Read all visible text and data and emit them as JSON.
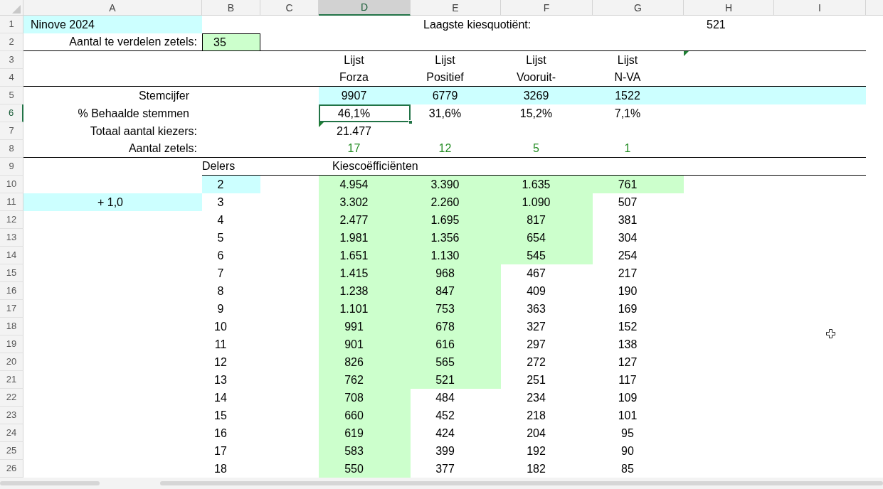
{
  "column_headers": [
    {
      "label": "A",
      "selected": false
    },
    {
      "label": "B",
      "selected": false
    },
    {
      "label": "C",
      "selected": false
    },
    {
      "label": "D",
      "selected": true
    },
    {
      "label": "E",
      "selected": false
    },
    {
      "label": "F",
      "selected": false
    },
    {
      "label": "G",
      "selected": false
    },
    {
      "label": "H",
      "selected": false
    },
    {
      "label": "I",
      "selected": false
    }
  ],
  "row_headers": [
    {
      "label": "1",
      "selected": false
    },
    {
      "label": "2",
      "selected": false
    },
    {
      "label": "3",
      "selected": false
    },
    {
      "label": "4",
      "selected": false
    },
    {
      "label": "5",
      "selected": false
    },
    {
      "label": "6",
      "selected": true
    },
    {
      "label": "7",
      "selected": false
    },
    {
      "label": "8",
      "selected": false
    },
    {
      "label": "9",
      "selected": false
    },
    {
      "label": "10",
      "selected": false
    },
    {
      "label": "11",
      "selected": false
    },
    {
      "label": "12",
      "selected": false
    },
    {
      "label": "13",
      "selected": false
    },
    {
      "label": "14",
      "selected": false
    },
    {
      "label": "15",
      "selected": false
    },
    {
      "label": "16",
      "selected": false
    },
    {
      "label": "17",
      "selected": false
    },
    {
      "label": "18",
      "selected": false
    },
    {
      "label": "19",
      "selected": false
    },
    {
      "label": "20",
      "selected": false
    },
    {
      "label": "21",
      "selected": false
    },
    {
      "label": "22",
      "selected": false
    },
    {
      "label": "23",
      "selected": false
    },
    {
      "label": "24",
      "selected": false
    },
    {
      "label": "25",
      "selected": false
    },
    {
      "label": "26",
      "selected": false
    }
  ],
  "title": "Ninove 2024",
  "lowest_quotient": {
    "label": "Laagste kiesquotiënt:",
    "value": "521"
  },
  "seats_to_distribute": {
    "label": "Aantal te verdelen zetels:",
    "value": "35"
  },
  "row_labels": {
    "votes": "Stemcijfer",
    "percent": "% Behaalde stemmen",
    "total_voters": "Totaal aantal kiezers:",
    "seats": "Aantal zetels:"
  },
  "total_voters": "21.477",
  "divisors_header": "Delers",
  "quotients_header": "Kiescoëfficiënten",
  "increment": "+ 1,0",
  "divisors": [
    "2",
    "3",
    "4",
    "5",
    "6",
    "7",
    "8",
    "9",
    "10",
    "11",
    "12",
    "13",
    "14",
    "15",
    "16",
    "17",
    "18"
  ],
  "parties": [
    {
      "line1": "Lijst",
      "line2": "Forza",
      "votes": "9907",
      "percent": "46,1%",
      "seats": "17",
      "quotients": [
        {
          "value": "4.954",
          "highlighted": true
        },
        {
          "value": "3.302",
          "highlighted": true
        },
        {
          "value": "2.477",
          "highlighted": true
        },
        {
          "value": "1.981",
          "highlighted": true
        },
        {
          "value": "1.651",
          "highlighted": true
        },
        {
          "value": "1.415",
          "highlighted": true
        },
        {
          "value": "1.238",
          "highlighted": true
        },
        {
          "value": "1.101",
          "highlighted": true
        },
        {
          "value": "991",
          "highlighted": true
        },
        {
          "value": "901",
          "highlighted": true
        },
        {
          "value": "826",
          "highlighted": true
        },
        {
          "value": "762",
          "highlighted": true
        },
        {
          "value": "708",
          "highlighted": true
        },
        {
          "value": "660",
          "highlighted": true
        },
        {
          "value": "619",
          "highlighted": true
        },
        {
          "value": "583",
          "highlighted": true
        },
        {
          "value": "550",
          "highlighted": true
        }
      ]
    },
    {
      "line1": "Lijst",
      "line2": "Positief",
      "votes": "6779",
      "percent": "31,6%",
      "seats": "12",
      "quotients": [
        {
          "value": "3.390",
          "highlighted": true
        },
        {
          "value": "2.260",
          "highlighted": true
        },
        {
          "value": "1.695",
          "highlighted": true
        },
        {
          "value": "1.356",
          "highlighted": true
        },
        {
          "value": "1.130",
          "highlighted": true
        },
        {
          "value": "968",
          "highlighted": true
        },
        {
          "value": "847",
          "highlighted": true
        },
        {
          "value": "753",
          "highlighted": true
        },
        {
          "value": "678",
          "highlighted": true
        },
        {
          "value": "616",
          "highlighted": true
        },
        {
          "value": "565",
          "highlighted": true
        },
        {
          "value": "521",
          "highlighted": true
        },
        {
          "value": "484",
          "highlighted": false
        },
        {
          "value": "452",
          "highlighted": false
        },
        {
          "value": "424",
          "highlighted": false
        },
        {
          "value": "399",
          "highlighted": false
        },
        {
          "value": "377",
          "highlighted": false
        }
      ]
    },
    {
      "line1": "Lijst",
      "line2": "Vooruit-",
      "votes": "3269",
      "percent": "15,2%",
      "seats": "5",
      "quotients": [
        {
          "value": "1.635",
          "highlighted": true
        },
        {
          "value": "1.090",
          "highlighted": true
        },
        {
          "value": "817",
          "highlighted": true
        },
        {
          "value": "654",
          "highlighted": true
        },
        {
          "value": "545",
          "highlighted": true
        },
        {
          "value": "467",
          "highlighted": false
        },
        {
          "value": "409",
          "highlighted": false
        },
        {
          "value": "363",
          "highlighted": false
        },
        {
          "value": "327",
          "highlighted": false
        },
        {
          "value": "297",
          "highlighted": false
        },
        {
          "value": "272",
          "highlighted": false
        },
        {
          "value": "251",
          "highlighted": false
        },
        {
          "value": "234",
          "highlighted": false
        },
        {
          "value": "218",
          "highlighted": false
        },
        {
          "value": "204",
          "highlighted": false
        },
        {
          "value": "192",
          "highlighted": false
        },
        {
          "value": "182",
          "highlighted": false
        }
      ]
    },
    {
      "line1": "Lijst",
      "line2": "N-VA",
      "votes": "1522",
      "percent": "7,1%",
      "seats": "1",
      "quotients": [
        {
          "value": "761",
          "highlighted": true
        },
        {
          "value": "507",
          "highlighted": false
        },
        {
          "value": "381",
          "highlighted": false
        },
        {
          "value": "304",
          "highlighted": false
        },
        {
          "value": "254",
          "highlighted": false
        },
        {
          "value": "217",
          "highlighted": false
        },
        {
          "value": "190",
          "highlighted": false
        },
        {
          "value": "169",
          "highlighted": false
        },
        {
          "value": "152",
          "highlighted": false
        },
        {
          "value": "138",
          "highlighted": false
        },
        {
          "value": "127",
          "highlighted": false
        },
        {
          "value": "117",
          "highlighted": false
        },
        {
          "value": "109",
          "highlighted": false
        },
        {
          "value": "101",
          "highlighted": false
        },
        {
          "value": "95",
          "highlighted": false
        },
        {
          "value": "90",
          "highlighted": false
        },
        {
          "value": "85",
          "highlighted": false
        }
      ]
    }
  ]
}
